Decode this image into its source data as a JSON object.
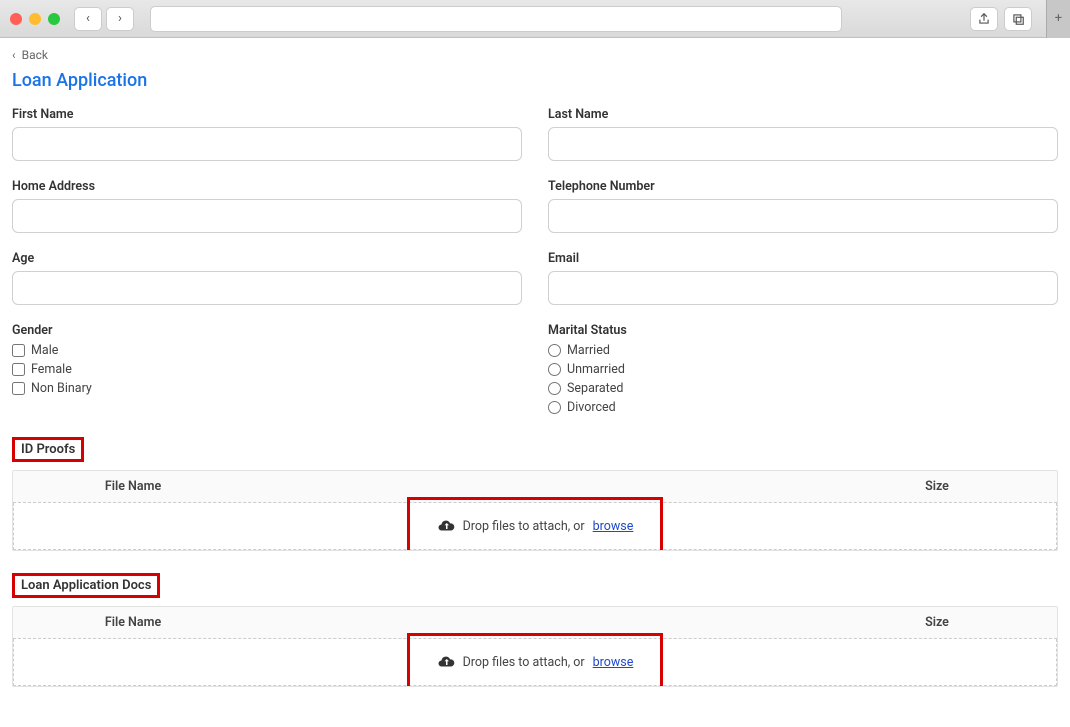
{
  "chrome": {
    "back_glyph": "‹",
    "forward_glyph": "›",
    "share_glyph": "⇧",
    "tabs_glyph": "❐",
    "plus_glyph": "+"
  },
  "nav": {
    "back_label": "Back",
    "back_chevron": "‹"
  },
  "title": "Loan Application",
  "fields": {
    "first_name": {
      "label": "First Name"
    },
    "last_name": {
      "label": "Last Name"
    },
    "home_address": {
      "label": "Home Address"
    },
    "telephone": {
      "label": "Telephone Number"
    },
    "age": {
      "label": "Age"
    },
    "email": {
      "label": "Email"
    },
    "gender": {
      "label": "Gender",
      "options": [
        "Male",
        "Female",
        "Non Binary"
      ]
    },
    "marital": {
      "label": "Marital Status",
      "options": [
        "Married",
        "Unmarried",
        "Separated",
        "Divorced"
      ]
    }
  },
  "sections": {
    "id_proofs": {
      "label": "ID Proofs",
      "col_filename": "File Name",
      "col_size": "Size",
      "drop_text": "Drop files to attach, or ",
      "browse": "browse"
    },
    "loan_docs": {
      "label": "Loan Application Docs",
      "col_filename": "File Name",
      "col_size": "Size",
      "drop_text": "Drop files to attach, or ",
      "browse": "browse"
    }
  }
}
